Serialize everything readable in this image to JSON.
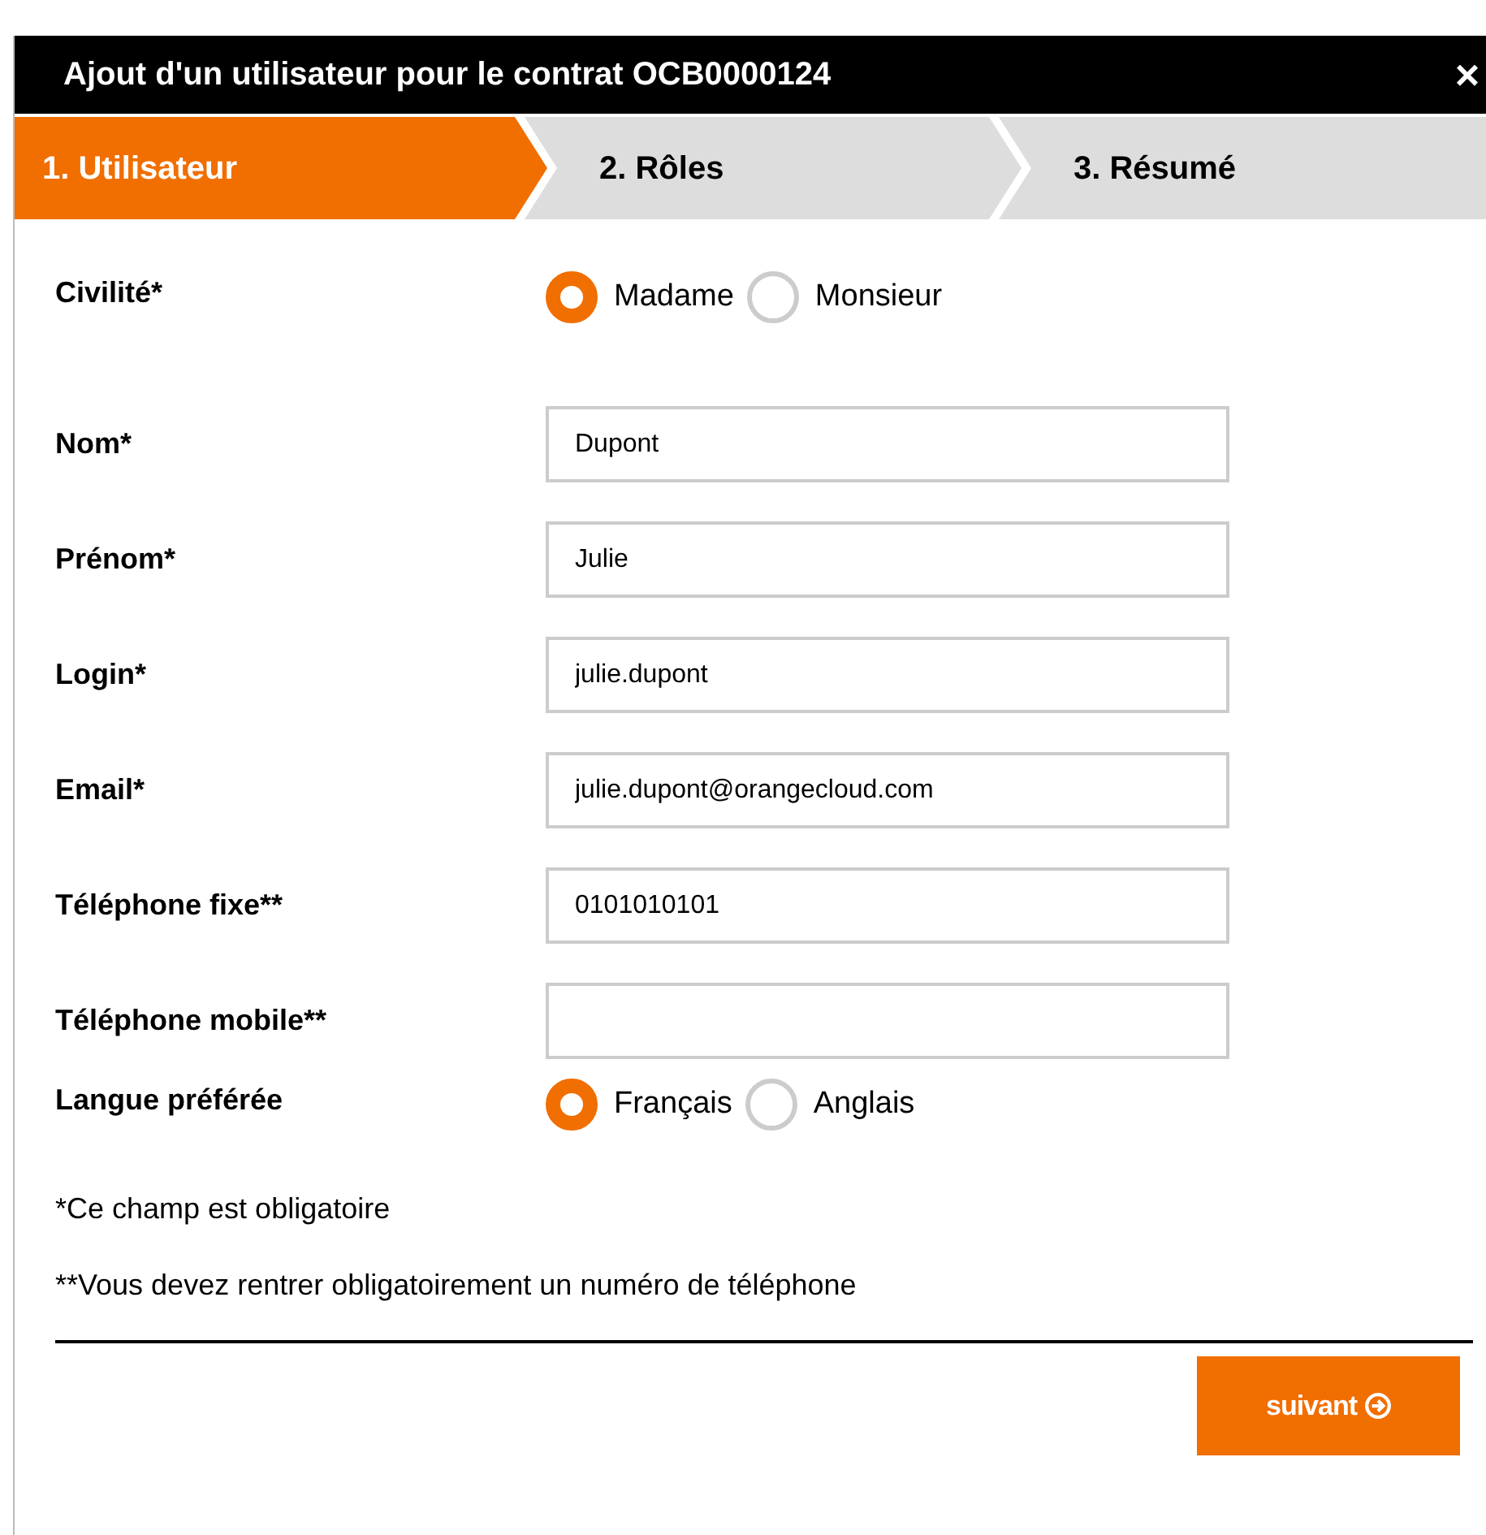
{
  "dialog": {
    "title": "Ajout d'un utilisateur pour le contrat OCB0000124",
    "close": "×"
  },
  "steps": [
    {
      "label": "1. Utilisateur",
      "selected": true
    },
    {
      "label": "2. Rôles",
      "selected": false
    },
    {
      "label": "3. Résumé",
      "selected": false
    }
  ],
  "fields": [
    {
      "kind": "radio",
      "label": "Civilité*",
      "options": [
        {
          "label": "Madame",
          "selected": true
        },
        {
          "label": "Monsieur",
          "selected": false
        }
      ]
    },
    {
      "kind": "text",
      "label": "Nom*",
      "value": "Dupont"
    },
    {
      "kind": "text",
      "label": "Prénom*",
      "value": "Julie"
    },
    {
      "kind": "text",
      "label": "Login*",
      "value": "julie.dupont"
    },
    {
      "kind": "text",
      "label": "Email*",
      "value": "julie.dupont@orangecloud.com"
    },
    {
      "kind": "text",
      "label": "Téléphone fixe**",
      "value": "0101010101"
    },
    {
      "kind": "text",
      "label": "Téléphone mobile**"
    },
    {
      "kind": "radio",
      "label": "Langue préférée",
      "options": [
        {
          "label": "Français",
          "selected": true
        },
        {
          "label": "Anglais",
          "selected": false
        }
      ]
    }
  ],
  "notes": [
    "*Ce champ est obligatoire",
    "**Vous devez rentrer obligatoirement un numéro de téléphone"
  ],
  "next_button": {
    "label": "suivant"
  }
}
